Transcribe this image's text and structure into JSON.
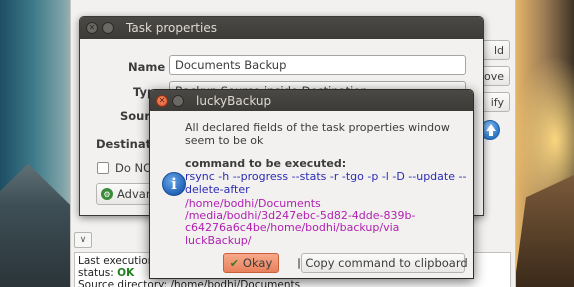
{
  "main_window": {
    "side_buttons": [
      "ld",
      "ove",
      "ify"
    ],
    "log": {
      "line1": "Last execution",
      "line2_prefix": "status: ",
      "line2_status": "OK",
      "line3": "Source directory: /home/bodhi/Documents"
    }
  },
  "task_properties": {
    "title": "Task properties",
    "name_label": "Name :",
    "name_value": "Documents Backup",
    "type_label": "Type :",
    "type_value": "Backup Source inside Destination",
    "source_label": "Sour",
    "destination_label": "Destinatio",
    "checkbox_label": "Do NO",
    "advanced_label": "Advan"
  },
  "dialog": {
    "title": "luckyBackup",
    "message": "All declared fields of the task properties window seem to be ok",
    "command_heading": "command to be executed:",
    "command_rsync": "rsync -h --progress --stats -r -tgo -p -l -D --update --delete-after",
    "path_line1": "/home/bodhi/Documents",
    "path_line2": "/media/bodhi/3d247ebc-5d82-4dde-839b-",
    "path_line3": "c64276a6c4be/home/bodhi/backup/via luckBackup/",
    "ok_label": "Okay",
    "copy_label": "Copy command to clipboard"
  },
  "colors": {
    "titlebar": "#3c3b37",
    "accent_close": "#e0532a",
    "rsync_text": "#2b2bb5",
    "path_text": "#b01fb0",
    "status_ok": "#1e7f1e"
  }
}
